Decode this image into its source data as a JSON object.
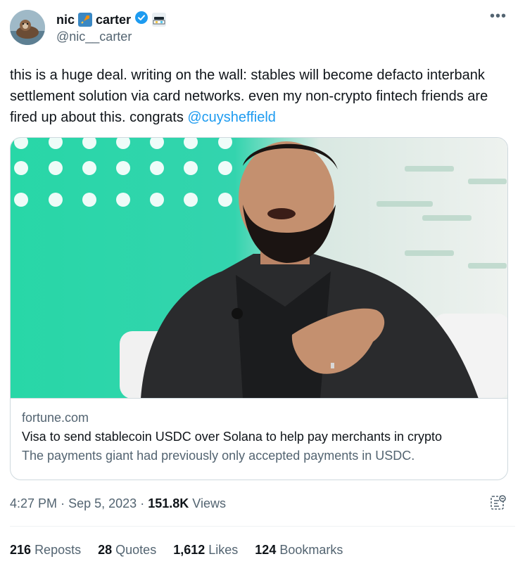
{
  "user": {
    "name_part1": "nic",
    "name_part2": "carter",
    "handle": "@nic__carter",
    "verified": true,
    "icons": [
      "rocket-emoji-icon",
      "verified-badge-icon",
      "sunglasses-emoji-icon"
    ]
  },
  "tweet": {
    "text": "this is a huge deal. writing on the wall: stables will become defacto interbank settlement solution via card networks. even my non-crypto fintech friends are fired up about this. congrats ",
    "mention": "@cuysheffield"
  },
  "card": {
    "domain": "fortune.com",
    "title": "Visa to send stablecoin USDC over Solana to help pay merchants in crypto",
    "description": "The payments giant had previously only accepted payments in USDC."
  },
  "meta": {
    "time": "4:27 PM",
    "separator": "·",
    "date": "Sep 5, 2023",
    "views_count": "151.8K",
    "views_label": "Views"
  },
  "stats": {
    "reposts_count": "216",
    "reposts_label": "Reposts",
    "quotes_count": "28",
    "quotes_label": "Quotes",
    "likes_count": "1,612",
    "likes_label": "Likes",
    "bookmarks_count": "124",
    "bookmarks_label": "Bookmarks"
  },
  "colors": {
    "accent": "#1d9bf0",
    "text": "#0f1419",
    "muted": "#536471",
    "image_left_bg": "#2ad6a6",
    "jacket": "#2a2b2d"
  }
}
